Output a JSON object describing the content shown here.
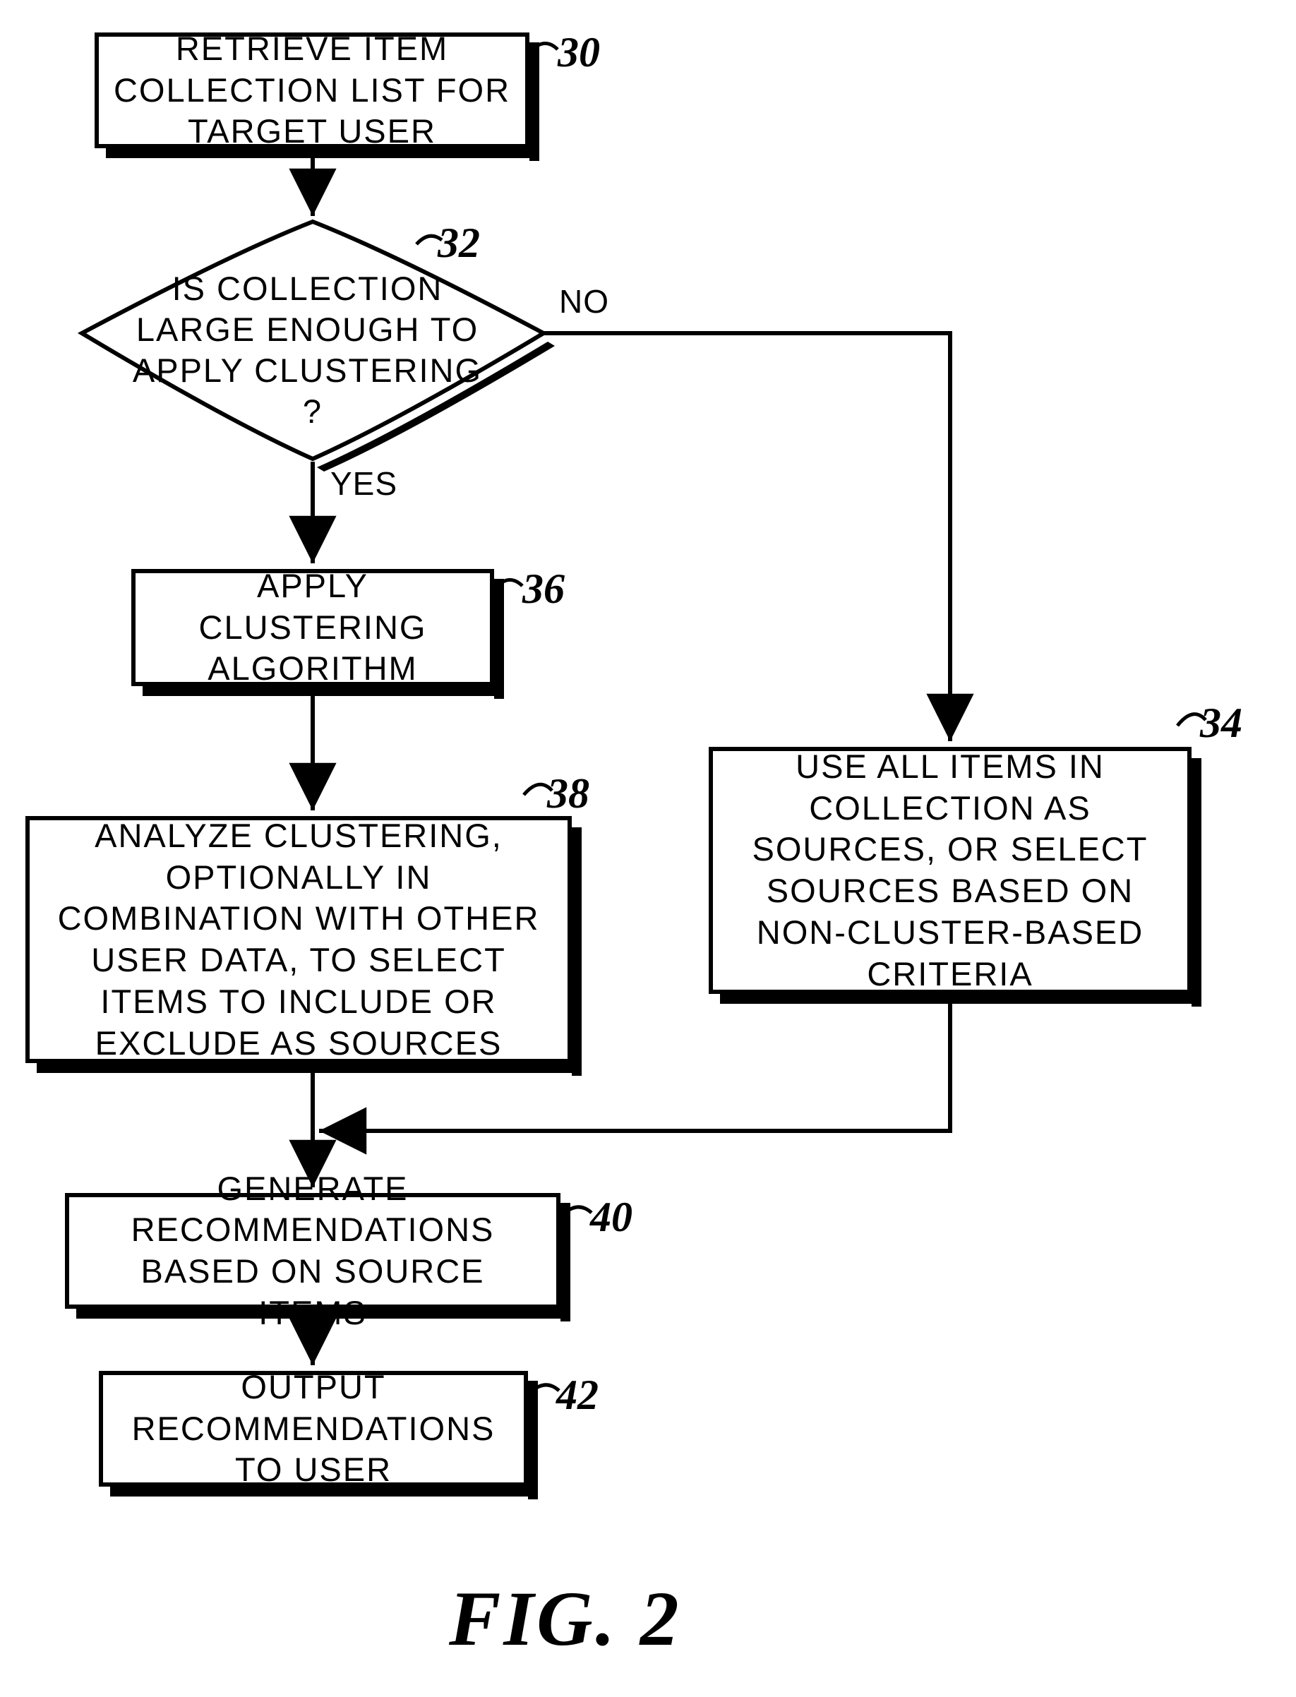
{
  "boxes": {
    "b30": {
      "text": "RETRIEVE ITEM COLLECTION LIST FOR TARGET USER",
      "ref": "30"
    },
    "d32": {
      "text": "IS COLLECTION LARGE ENOUGH TO APPLY CLUSTERING ?",
      "ref": "32"
    },
    "b36": {
      "text": "APPLY CLUSTERING ALGORITHM",
      "ref": "36"
    },
    "b38": {
      "text": "ANALYZE CLUSTERING, OPTIONALLY IN COMBINATION WITH OTHER USER DATA, TO SELECT ITEMS TO INCLUDE OR EXCLUDE AS SOURCES",
      "ref": "38"
    },
    "b34": {
      "text": "USE ALL ITEMS IN COLLECTION AS SOURCES, OR SELECT SOURCES BASED ON NON-CLUSTER-BASED CRITERIA",
      "ref": "34"
    },
    "b40": {
      "text": "GENERATE RECOMMENDATIONS BASED ON SOURCE ITEMS",
      "ref": "40"
    },
    "b42": {
      "text": "OUTPUT RECOMMENDATIONS TO USER",
      "ref": "42"
    }
  },
  "branches": {
    "yes": "YES",
    "no": "NO"
  },
  "figure": "FIG.  2"
}
